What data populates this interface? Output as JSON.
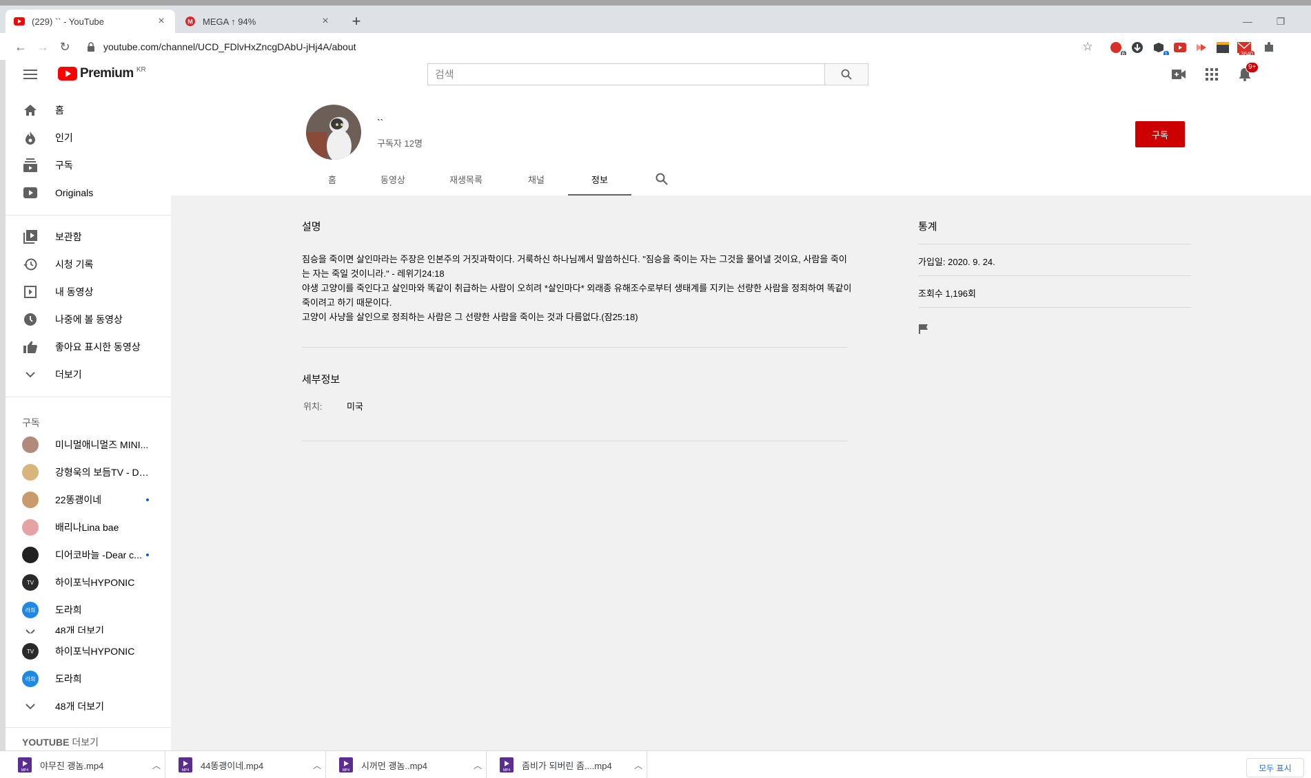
{
  "browser": {
    "tabs": [
      {
        "title": "(229) `` - YouTube",
        "active": true
      },
      {
        "title": "MEGA ↑ 94%",
        "active": false
      }
    ],
    "new_tab_label": "+",
    "url": "youtube.com/channel/UCD_FDlvHxZncgDAbU-jHj4A/about",
    "extension_badges": [
      "6",
      "1",
      "3640"
    ],
    "window_controls": {
      "minimize": "—",
      "restore": "❐"
    }
  },
  "youtube": {
    "logo_text": "Premium",
    "logo_country": "KR",
    "search_placeholder": "검색",
    "notification_count": "9+"
  },
  "sidebar": {
    "main": [
      {
        "label": "홈",
        "icon": "home-icon"
      },
      {
        "label": "인기",
        "icon": "fire-icon"
      },
      {
        "label": "구독",
        "icon": "subscriptions-icon"
      },
      {
        "label": "Originals",
        "icon": "originals-icon"
      }
    ],
    "library": [
      {
        "label": "보관함",
        "icon": "library-icon"
      },
      {
        "label": "시청 기록",
        "icon": "history-icon"
      },
      {
        "label": "내 동영상",
        "icon": "my-videos-icon"
      },
      {
        "label": "나중에 볼 동영상",
        "icon": "watch-later-icon"
      },
      {
        "label": "좋아요 표시한 동영상",
        "icon": "liked-icon"
      },
      {
        "label": "더보기",
        "icon": "chevron-down-icon"
      }
    ],
    "subscriptions_heading": "구독",
    "subscriptions": [
      {
        "label": "미니멀애니멀즈 MINI...",
        "color": "#b08a7a",
        "dot": false
      },
      {
        "label": "강형욱의 보듬TV - Do...",
        "color": "#d8b57a",
        "dot": false
      },
      {
        "label": "22똥괭이네",
        "color": "#c99a6a",
        "dot": true
      },
      {
        "label": "배리나Lina bae",
        "color": "#e6a3a3",
        "dot": false
      },
      {
        "label": "디어코바늘 -Dear c...",
        "color": "#222222",
        "dot": true
      },
      {
        "label": "하이포닉HYPONIC",
        "color": "#2a2a2a",
        "dot": false
      },
      {
        "label": "도라희",
        "color": "#1e88e5",
        "dot": false
      }
    ],
    "more_partial": "48개 더보기",
    "subscriptions_repeat": [
      {
        "label": "하이포닉HYPONIC",
        "color": "#2a2a2a"
      },
      {
        "label": "도라희",
        "color": "#1e88e5"
      }
    ],
    "more_label": "48개 더보기",
    "youtube_more_bold": "YOUTUBE",
    "youtube_more_rest": "더보기"
  },
  "channel": {
    "name": "``",
    "subscribers": "구독자 12명",
    "subscribe_label": "구독",
    "tabs": [
      "홈",
      "동영상",
      "재생목록",
      "채널",
      "정보"
    ],
    "selected_tab": "정보"
  },
  "about": {
    "description_title": "설명",
    "description": "짐승을 죽이면 살인마라는 주장은 인본주의 거짓과학이다. 거룩하신 하나님께서 말씀하신다. \"짐승을 죽이는 자는 그것을 물어낼 것이요, 사람을 죽이는 자는 죽일 것이니라.\" - 레위기24:18\n야생 고양이를 죽인다고 살인마와 똑같이 취급하는 사람이 오히려 *살인마다*  외래종 유해조수로부터 생태계를 지키는 선량한 사람을 정죄하여 똑같이 죽이려고 하기 때문이다.\n고양이 사냥을 살인으로 정죄하는 사람은 그 선량한 사람을 죽이는 것과 다름없다.(잠25:18)",
    "details_title": "세부정보",
    "location_label": "위치:",
    "location_value": "미국",
    "stats_title": "통계",
    "joined": "가입일: 2020. 9. 24.",
    "views": "조회수 1,196회"
  },
  "downloads": {
    "items": [
      "야무진 괭놈.mp4",
      "44똥괭이네.mp4",
      "시꺼먼 괭놈..mp4",
      "좀비가 되버린 좀....mp4"
    ],
    "show_all": "모두 표시"
  }
}
